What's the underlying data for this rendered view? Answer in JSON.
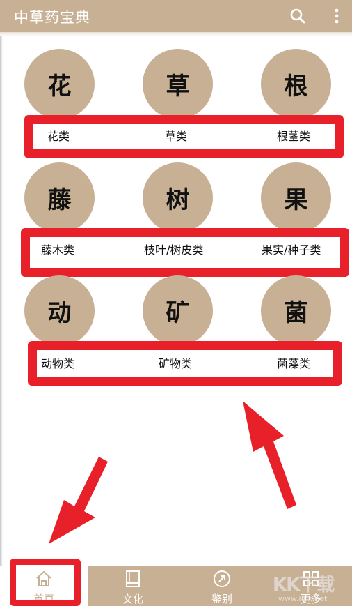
{
  "app": {
    "title": "中草药宝典"
  },
  "colors": {
    "brand": "#c8b095",
    "annotation_red": "#e8202a",
    "text": "#111111"
  },
  "header": {
    "icons": [
      "search-icon",
      "more-vert-icon"
    ]
  },
  "categories": [
    {
      "glyph": "花",
      "label": "花类"
    },
    {
      "glyph": "草",
      "label": "草类"
    },
    {
      "glyph": "根",
      "label": "根茎类"
    },
    {
      "glyph": "藤",
      "label": "藤木类"
    },
    {
      "glyph": "树",
      "label": "枝叶/树皮类"
    },
    {
      "glyph": "果",
      "label": "果实/种子类"
    },
    {
      "glyph": "动",
      "label": "动物类"
    },
    {
      "glyph": "矿",
      "label": "矿物类"
    },
    {
      "glyph": "菌",
      "label": "菌藻类"
    }
  ],
  "bottom_nav": [
    {
      "label": "首页",
      "icon": "home-icon",
      "active": true
    },
    {
      "label": "文化",
      "icon": "book-icon",
      "active": false
    },
    {
      "label": "鉴别",
      "icon": "compass-icon",
      "active": false
    },
    {
      "label": "更多",
      "icon": "grid-icon",
      "active": false
    }
  ],
  "watermark": {
    "text": "KK下载",
    "sub": "www.kkx.net"
  }
}
